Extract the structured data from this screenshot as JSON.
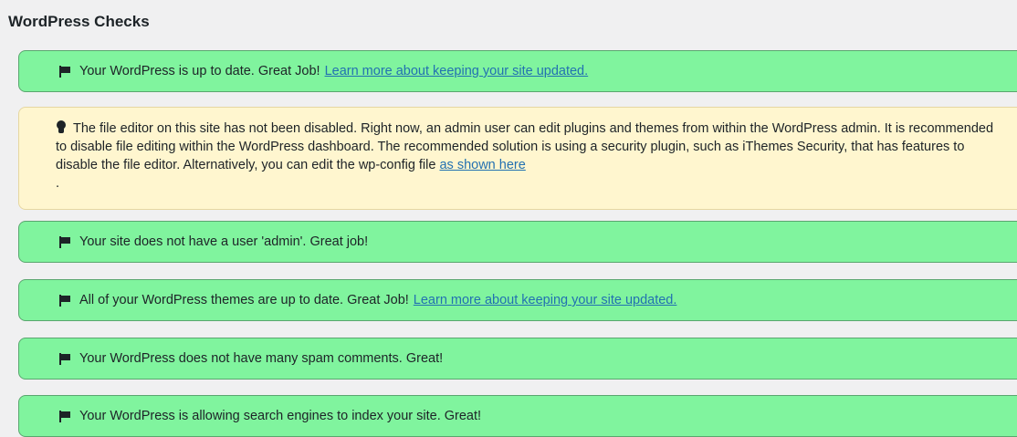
{
  "section": {
    "title": "WordPress Checks"
  },
  "checks": [
    {
      "icon": "flag-icon",
      "text": "Your WordPress is up to date. Great Job!",
      "link": "Learn more about keeping your site updated."
    },
    {
      "icon": "lightbulb-icon",
      "text": "The file editor on this site has not been disabled. Right now, an admin user can edit plugins and themes from within the WordPress admin. It is recommended to disable file editing within the WordPress dashboard. The recommended solution is using a security plugin, such as iThemes Security, that has features to disable the file editor. Alternatively, you can edit the wp-config file",
      "link": "as shown here",
      "tail": "."
    },
    {
      "icon": "flag-icon",
      "text": "Your site does not have a user 'admin'. Great job!"
    },
    {
      "icon": "flag-icon",
      "text": "All of your WordPress themes are up to date. Great Job!",
      "link": "Learn more about keeping your site updated."
    },
    {
      "icon": "flag-icon",
      "text": "Your WordPress does not have many spam comments. Great!"
    },
    {
      "icon": "flag-icon",
      "text": "Your WordPress is allowing search engines to index your site. Great!"
    }
  ],
  "colors": {
    "success_bg": "#80f49e",
    "warning_bg": "#fff6cf",
    "link": "#2271b1",
    "page_bg": "#f0f0f1"
  }
}
